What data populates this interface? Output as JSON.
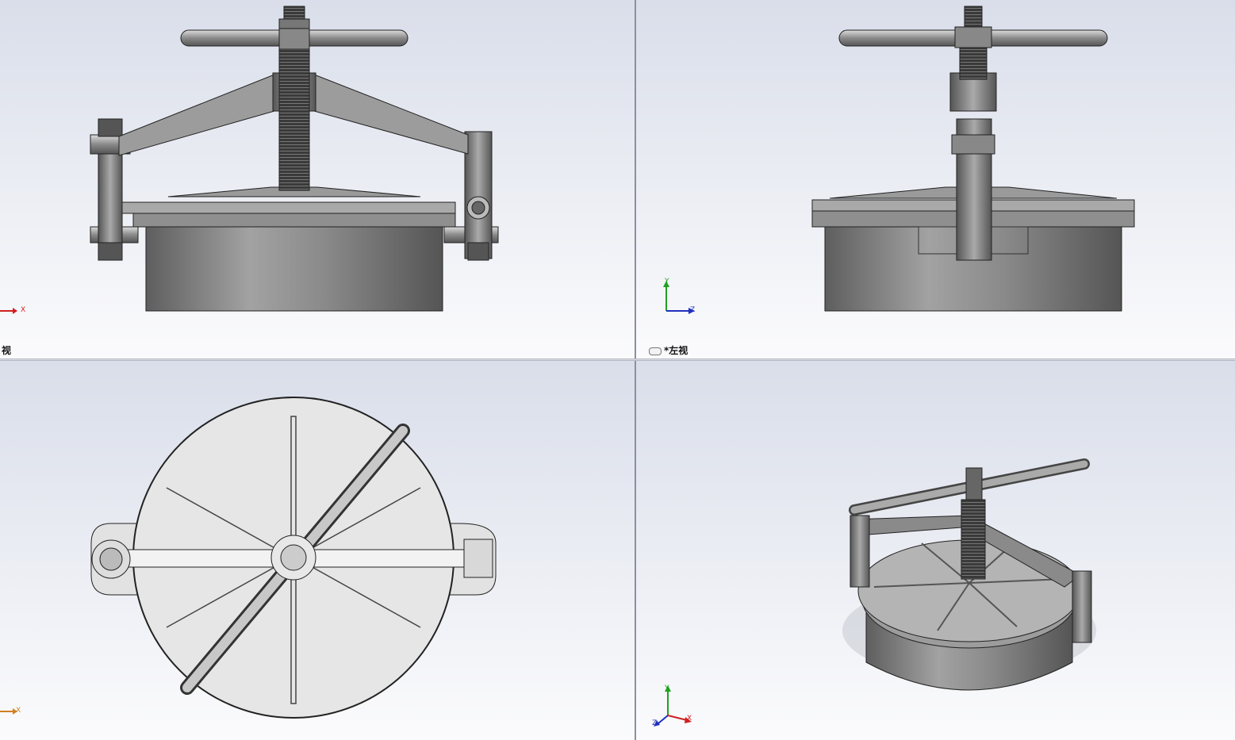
{
  "views": {
    "front": {
      "label": "视"
    },
    "left": {
      "label": "*左视"
    },
    "top": {
      "label": ""
    },
    "iso": {
      "label": ""
    }
  },
  "triad": {
    "x": "X",
    "y": "Y",
    "z": "Z"
  },
  "colors": {
    "background_top": "#d9deea",
    "background_bottom": "#fbfbfd",
    "metal_dark": "#4a4a4a",
    "metal_mid": "#8a8a8a",
    "metal_light": "#c9c9c9",
    "axis_x": "#d02020",
    "axis_y": "#20a020",
    "axis_z": "#2030c0"
  }
}
